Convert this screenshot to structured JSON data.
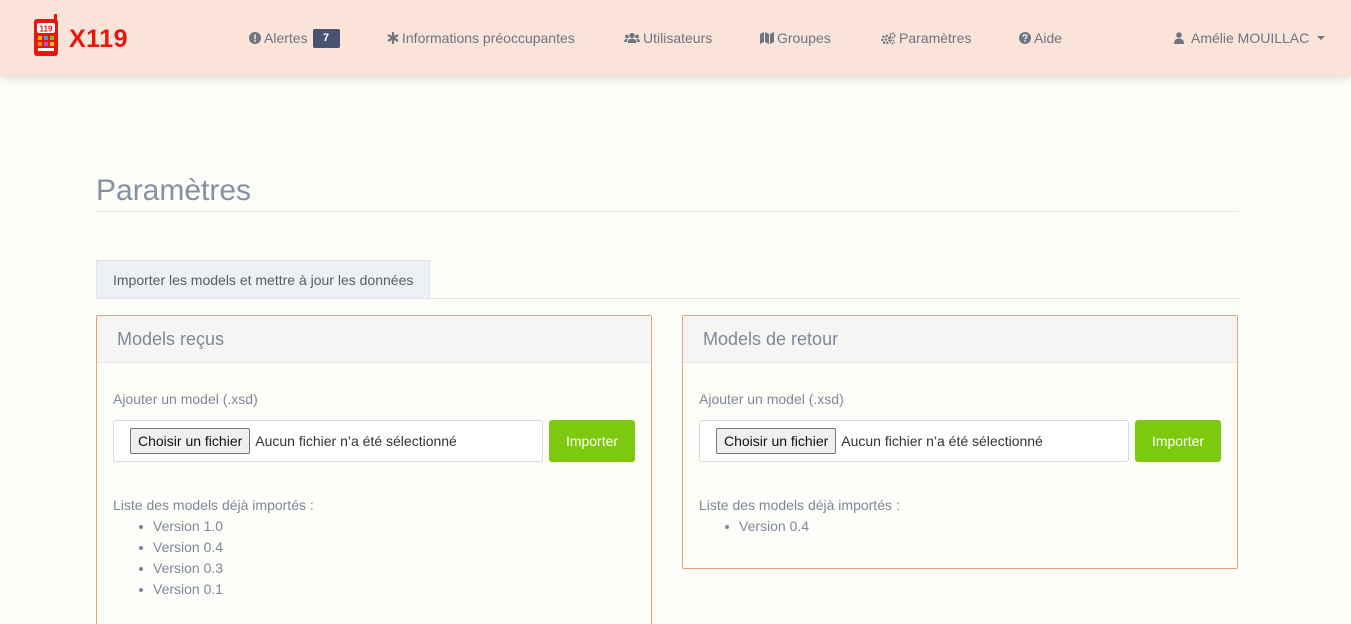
{
  "brand": {
    "name": "X119",
    "logo_badge": "119",
    "color": "#e8170e"
  },
  "nav": {
    "alerts": {
      "label": "Alertes",
      "count": "7",
      "icon": "exclamation-circle-icon"
    },
    "info": {
      "label": "Informations préoccupantes",
      "icon": "asterisk-icon"
    },
    "users": {
      "label": "Utilisateurs",
      "icon": "users-icon"
    },
    "groups": {
      "label": "Groupes",
      "icon": "map-icon"
    },
    "settings": {
      "label": "Paramètres",
      "icon": "gears-icon"
    },
    "help": {
      "label": "Aide",
      "icon": "question-circle-icon"
    },
    "user": {
      "name": "Amélie MOUILLAC",
      "icon": "user-icon"
    }
  },
  "page": {
    "title": "Paramètres"
  },
  "tabs": [
    {
      "label": "Importer les models et mettre à jour les données"
    }
  ],
  "panels": {
    "received": {
      "title": "Models reçus",
      "field_label": "Ajouter un model (.xsd)",
      "file_button": "Choisir un fichier",
      "file_status": "Aucun fichier n’a été sélectionné",
      "import_label": "Importer",
      "list_label": "Liste des models déjà importés :",
      "versions": [
        "Version 1.0",
        "Version 0.4",
        "Version 0.3",
        "Version 0.1"
      ]
    },
    "returned": {
      "title": "Models de retour",
      "field_label": "Ajouter un model (.xsd)",
      "file_button": "Choisir un fichier",
      "file_status": "Aucun fichier n’a été sélectionné",
      "import_label": "Importer",
      "list_label": "Liste des models déjà importés :",
      "versions": [
        "Version 0.4"
      ]
    }
  },
  "colors": {
    "navbar": "#fae3d9",
    "accent_green": "#7dc90d",
    "panel_border": "#eba176",
    "badge": "#495270"
  }
}
